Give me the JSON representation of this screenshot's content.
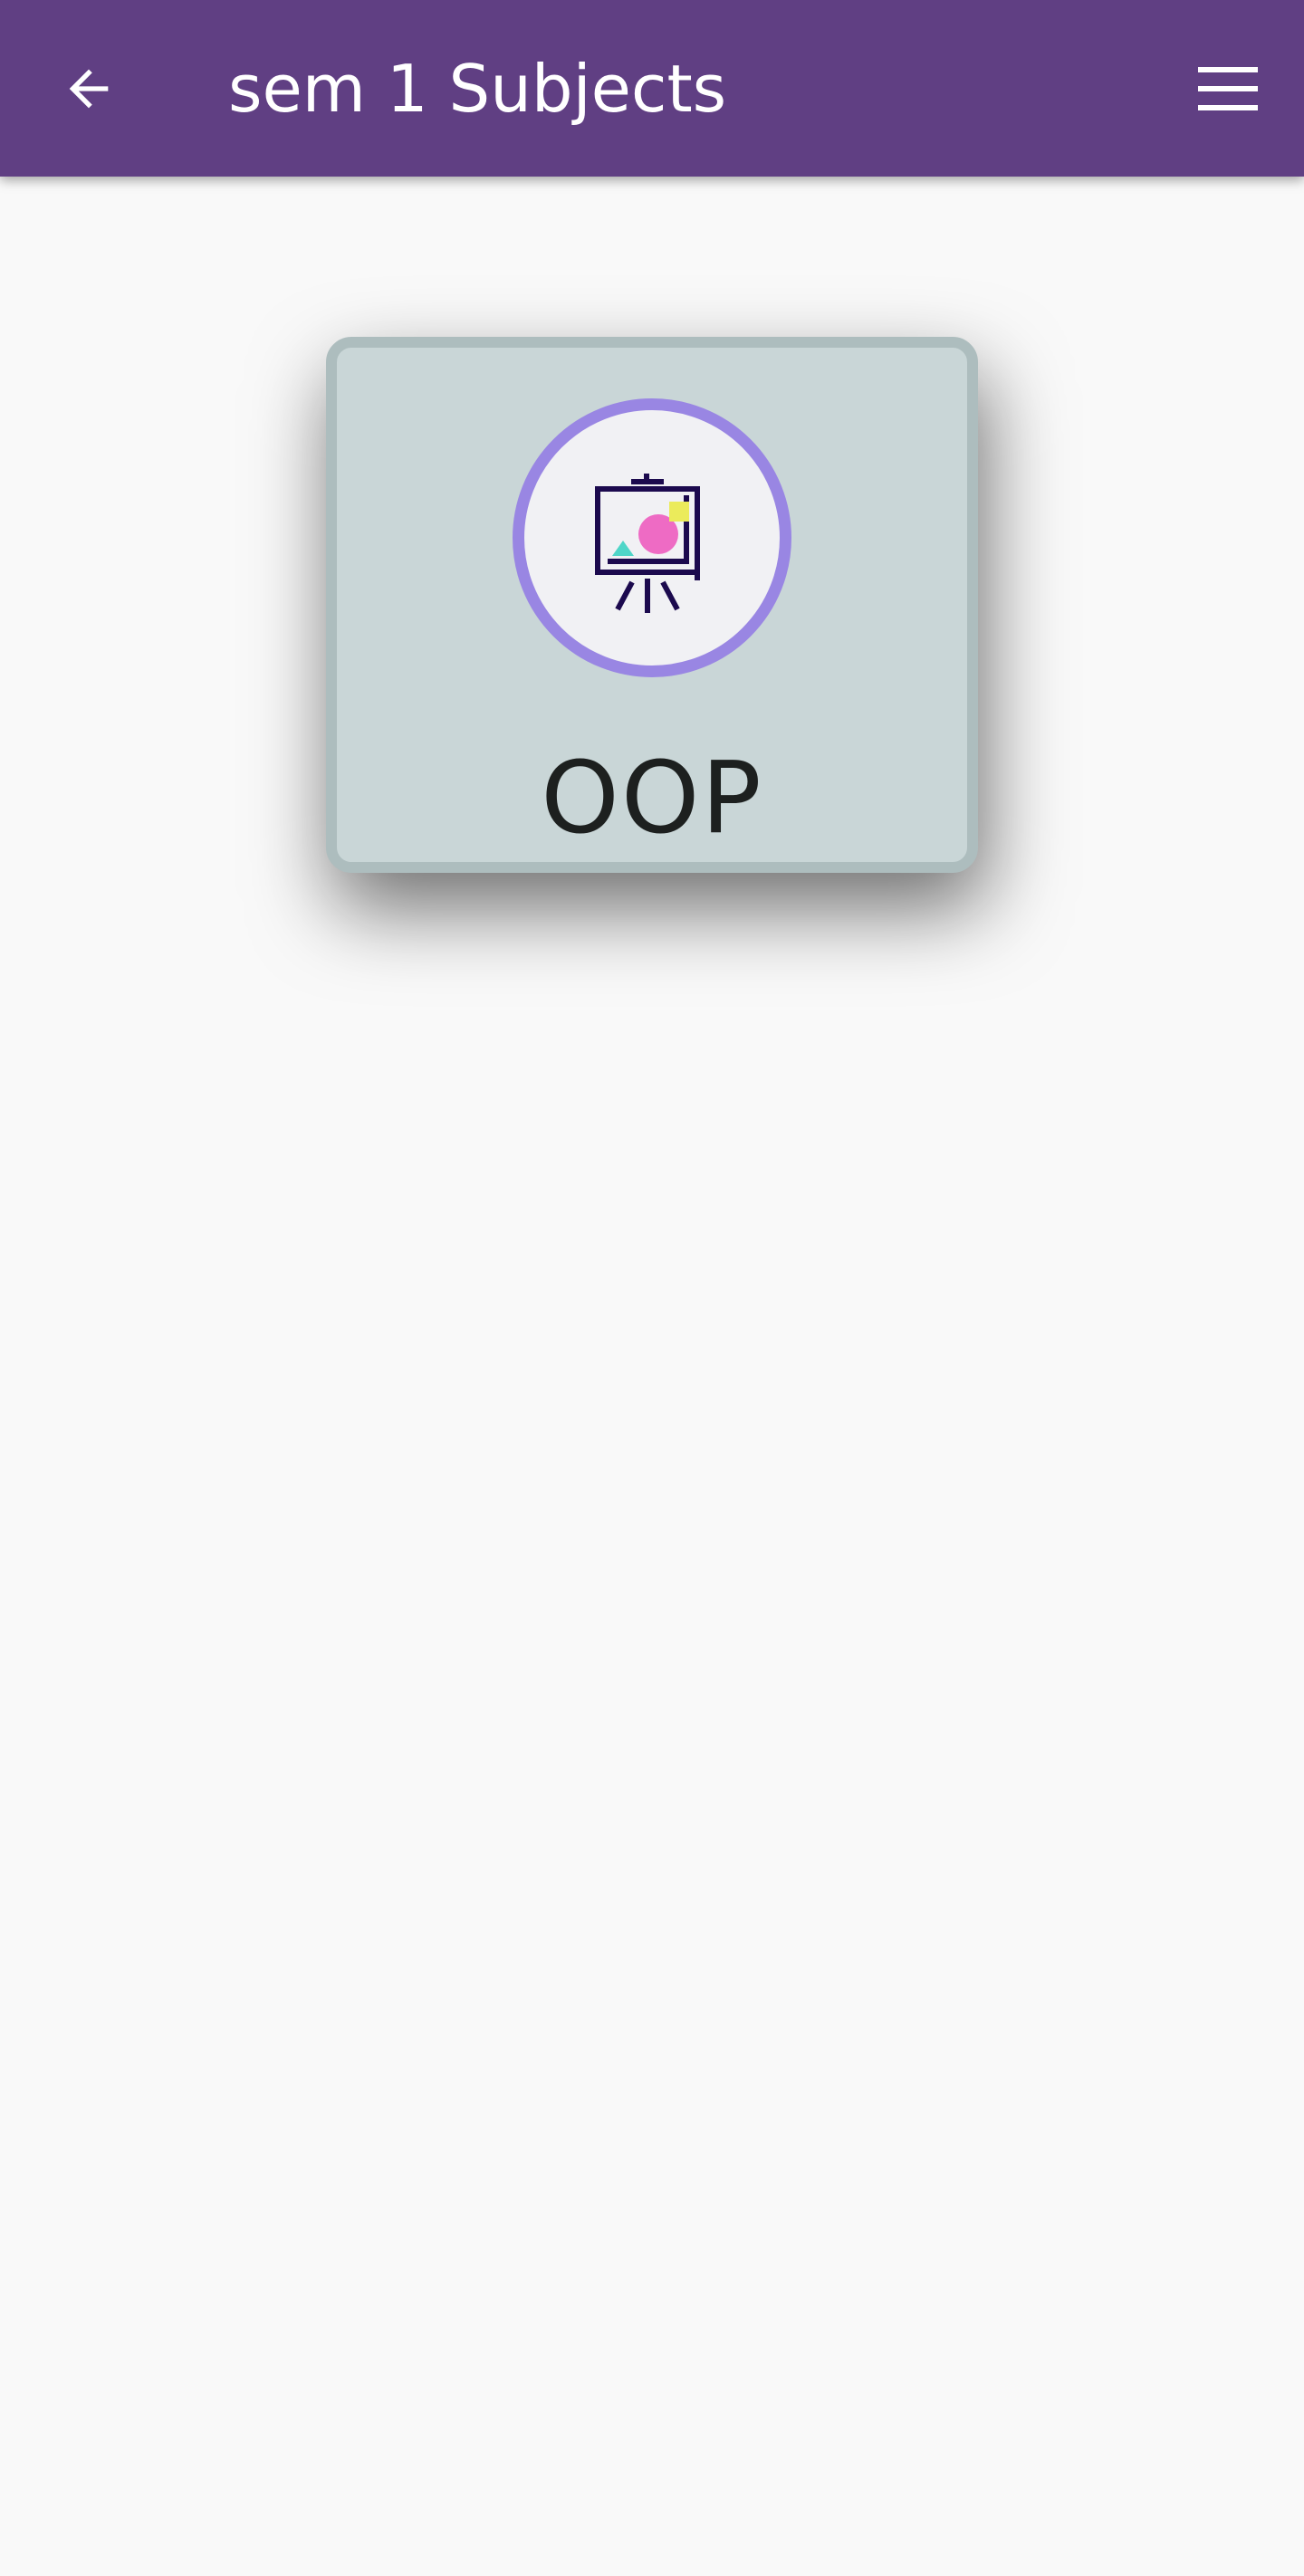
{
  "app_bar": {
    "title": "sem 1 Subjects",
    "back_icon": "arrow-left-icon",
    "menu_icon": "hamburger-menu-icon",
    "background_color": "#603f83"
  },
  "subjects": [
    {
      "label": "OOP",
      "icon": "presentation-easel-icon"
    }
  ],
  "colors": {
    "card_background": "#c9d6d7",
    "card_border": "#adbdbe",
    "icon_ring": "#9986e3",
    "page_background": "#f9f9f9"
  }
}
